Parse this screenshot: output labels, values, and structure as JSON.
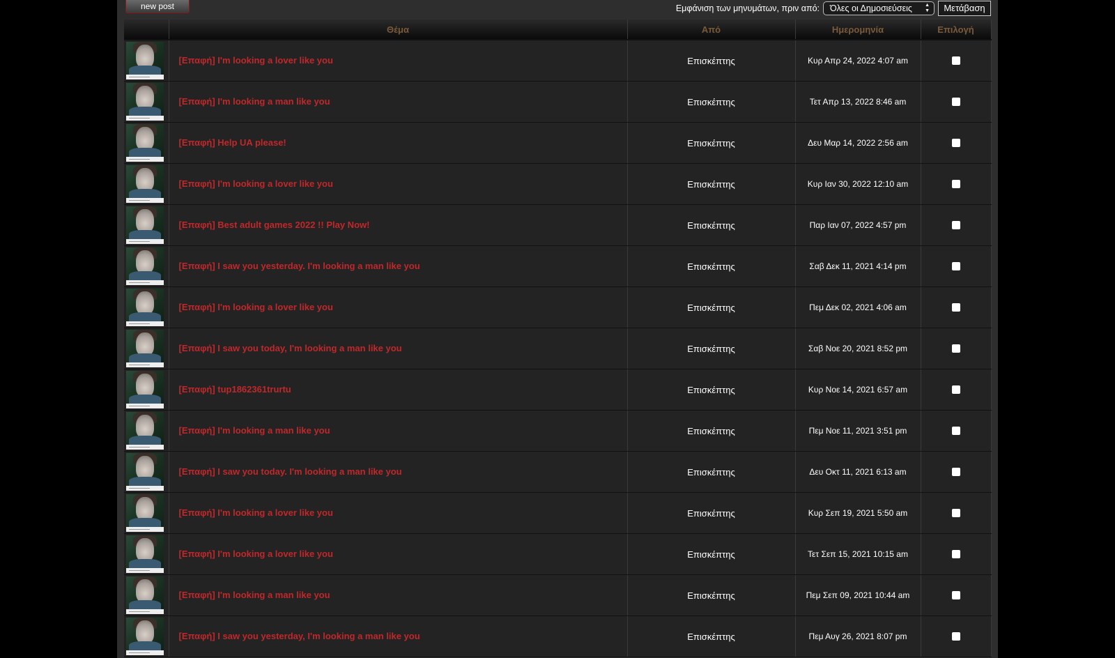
{
  "toolbar": {
    "new_post_label": "new post",
    "filter_label": "Εμφάνιση των μηνυμάτων, πριν από:",
    "filter_selected": "Όλες οι Δημοσιεύσεις",
    "go_label": "Μετάβαση"
  },
  "table": {
    "headers": {
      "topic": "Θέμα",
      "author": "Από",
      "date": "Ημερομηνία",
      "select": "Επιλογή"
    },
    "rows": [
      {
        "topic": "[Επαφή] I'm looking a lover like you",
        "author": "Επισκέπτης",
        "date": "Κυρ Απρ 24, 2022 4:07 am"
      },
      {
        "topic": "[Επαφή] I'm looking a man like you",
        "author": "Επισκέπτης",
        "date": "Τετ Απρ 13, 2022 8:46 am"
      },
      {
        "topic": "[Επαφή] Help UA please!",
        "author": "Επισκέπτης",
        "date": "Δευ Μαρ 14, 2022 2:56 am"
      },
      {
        "topic": "[Επαφή] I'm looking a lover like you",
        "author": "Επισκέπτης",
        "date": "Κυρ Ιαν 30, 2022 12:10 am"
      },
      {
        "topic": "[Επαφή] Best adult games 2022 !! Play Now!",
        "author": "Επισκέπτης",
        "date": "Παρ Ιαν 07, 2022 4:57 pm"
      },
      {
        "topic": "[Επαφή] I saw you yesterday. I'm looking a man like you",
        "author": "Επισκέπτης",
        "date": "Σαβ Δεκ 11, 2021 4:14 pm"
      },
      {
        "topic": "[Επαφή] I'm looking a lover like you",
        "author": "Επισκέπτης",
        "date": "Πεμ Δεκ 02, 2021 4:06 am"
      },
      {
        "topic": "[Επαφή] I saw you today, I'm looking a man like you",
        "author": "Επισκέπτης",
        "date": "Σαβ Νοε 20, 2021 8:52 pm"
      },
      {
        "topic": "[Επαφή] tup1862361trurtu",
        "author": "Επισκέπτης",
        "date": "Κυρ Νοε 14, 2021 6:57 am"
      },
      {
        "topic": "[Επαφή] I'm looking a man like you",
        "author": "Επισκέπτης",
        "date": "Πεμ Νοε 11, 2021 3:51 pm"
      },
      {
        "topic": "[Επαφή] I saw you today. I'm looking a man like you",
        "author": "Επισκέπτης",
        "date": "Δευ Οκτ 11, 2021 6:13 am"
      },
      {
        "topic": "[Επαφή] I'm looking a lover like you",
        "author": "Επισκέπτης",
        "date": "Κυρ Σεπ 19, 2021 5:50 am"
      },
      {
        "topic": "[Επαφή] I'm looking a lover like you",
        "author": "Επισκέπτης",
        "date": "Τετ Σεπ 15, 2021 10:15 am"
      },
      {
        "topic": "[Επαφή] I'm looking a man like you",
        "author": "Επισκέπτης",
        "date": "Πεμ Σεπ 09, 2021 10:44 am"
      },
      {
        "topic": "[Επαφή] I saw you yesterday, I'm looking a man like you",
        "author": "Επισκέπτης",
        "date": "Πεμ Αυγ 26, 2021 8:07 pm"
      }
    ]
  },
  "colors": {
    "topic_link": "#c0282b",
    "header_text": "#7a5a3a",
    "row_bg": "#232323",
    "page_bg": "#2e2e2e"
  },
  "icons": {
    "row_avatar": "avatar-image",
    "row_checkbox": "checkbox"
  }
}
